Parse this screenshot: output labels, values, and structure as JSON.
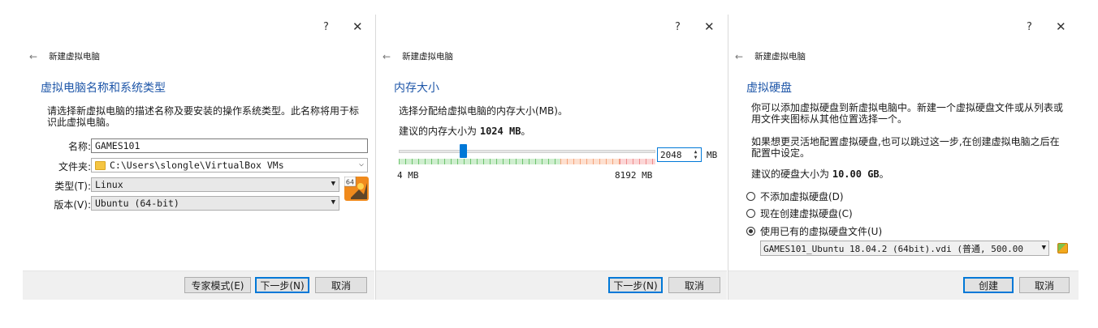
{
  "common": {
    "help_glyph": "?",
    "close_glyph": "✕",
    "back_glyph": "←",
    "wizard_title": "新建虚拟电脑",
    "accent_color": "#1e56a8"
  },
  "panel1": {
    "heading": "虚拟电脑名称和系统类型",
    "description": "请选择新虚拟电脑的描述名称及要安装的操作系统类型。此名称将用于标识此虚拟电脑。",
    "name_label": "名称:",
    "name_value": "GAMES101",
    "folder_label": "文件夹:",
    "folder_value": "C:\\Users\\slongle\\VirtualBox VMs",
    "type_label": "类型(T):",
    "type_value": "Linux",
    "version_label": "版本(V):",
    "version_value": "Ubuntu (64-bit)",
    "os_icon_badge": "64",
    "buttons": {
      "expert": "专家模式(E)",
      "next": "下一步(N)",
      "cancel": "取消"
    }
  },
  "panel2": {
    "heading": "内存大小",
    "description": "选择分配给虚拟电脑的内存大小(MB)。",
    "recommend_prefix": "建议的内存大小为",
    "recommend_value": "1024 MB",
    "recommend_suffix": "。",
    "memory_value": "2048",
    "unit": "MB",
    "min_label": "4 MB",
    "max_label": "8192 MB",
    "slider_fraction": 0.25,
    "buttons": {
      "next": "下一步(N)",
      "cancel": "取消"
    }
  },
  "panel3": {
    "heading": "虚拟硬盘",
    "description1": "你可以添加虚拟硬盘到新虚拟电脑中。新建一个虚拟硬盘文件或从列表或用文件夹图标从其他位置选择一个。",
    "description2": "如果想更灵活地配置虚拟硬盘,也可以跳过这一步,在创建虚拟电脑之后在配置中设定。",
    "recommend_prefix": "建议的硬盘大小为",
    "recommend_value": "10.00 GB",
    "recommend_suffix": "。",
    "options": [
      {
        "label": "不添加虚拟硬盘(D)",
        "checked": false
      },
      {
        "label": "现在创建虚拟硬盘(C)",
        "checked": false
      },
      {
        "label": "使用已有的虚拟硬盘文件(U)",
        "checked": true
      }
    ],
    "disk_file": "GAMES101_Ubuntu 18.04.2 (64bit).vdi (普通, 500.00",
    "buttons": {
      "create": "创建",
      "cancel": "取消"
    }
  }
}
